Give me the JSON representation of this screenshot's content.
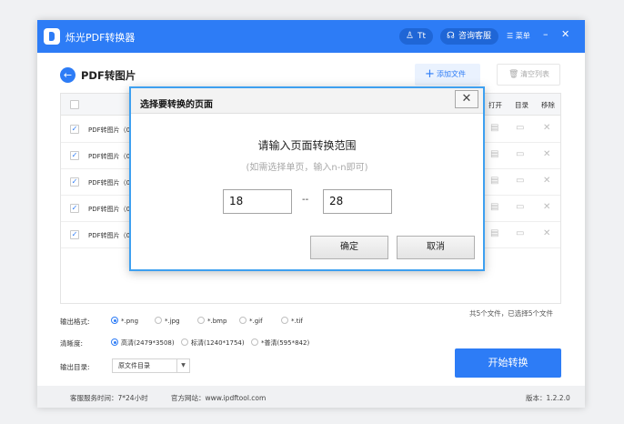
{
  "window": {
    "app_title": "烁光PDF转换器",
    "user_label": "Tt",
    "service_label": "咨询客服",
    "menu_label": "菜单",
    "minimize": "–",
    "close": "✕",
    "accent": "#2d7cf6"
  },
  "toolbar": {
    "back_icon": "←",
    "page_title": "PDF转图片",
    "add_label": "添加文件",
    "clear_label": "清空列表"
  },
  "table": {
    "headers": {
      "open": "打开",
      "dir": "目录",
      "remove": "移除"
    },
    "rows": [
      {
        "name": "PDF转图片（0",
        "checked": "✓"
      },
      {
        "name": "PDF转图片（0",
        "checked": "✓"
      },
      {
        "name": "PDF转图片（0",
        "checked": "✓"
      },
      {
        "name": "PDF转图片（0",
        "checked": "✓"
      },
      {
        "name": "PDF转图片（0",
        "checked": "✓"
      }
    ],
    "summary": "共5个文件，已选择5个文件"
  },
  "options": {
    "format_label": "输出格式:",
    "formats": [
      "*.png",
      "*.jpg",
      "*.bmp",
      "*.gif",
      "*.tif"
    ],
    "clarity_label": "清晰度:",
    "clarities": [
      "高清(2479*3508)",
      "标清(1240*1754)",
      "*普清(595*842)"
    ],
    "output_label": "输出目录:",
    "output_value": "原文件目录"
  },
  "start_label": "开始转换",
  "footer": {
    "hours": "客服服务时间：7*24小时",
    "site": "官方网站：www.ipdftool.com",
    "version": "版本：1.2.2.0"
  },
  "dialog": {
    "title": "选择要转换的页面",
    "close": "✕",
    "heading": "请输入页面转换范围",
    "hint": "(如需选择单页，输入n-n即可)",
    "from": "18",
    "separator": "--",
    "to": "28",
    "ok": "确定",
    "cancel": "取消"
  }
}
